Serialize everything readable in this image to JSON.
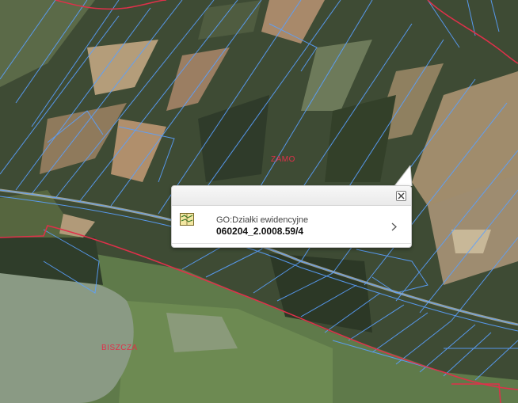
{
  "map": {
    "labels": {
      "area1": "ZAMO",
      "area2": "BISZCZA"
    },
    "colors": {
      "parcel_border": "#5aa0ff",
      "admin_border": "#e0304a",
      "label": "#e0304a"
    }
  },
  "popup": {
    "layer_name": "GO:Działki ewidencyjne",
    "feature_id": "060204_2.0008.59/4",
    "icons": {
      "layer": "parcel-layer-icon",
      "close": "close-icon",
      "expand": "chevron-right-icon"
    }
  }
}
